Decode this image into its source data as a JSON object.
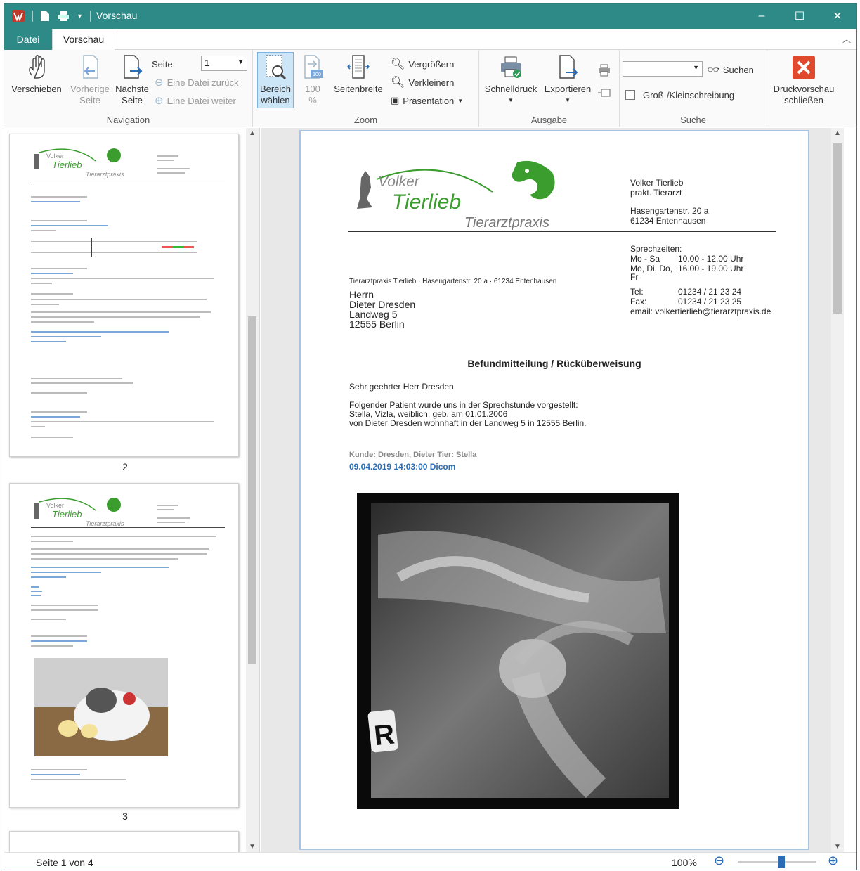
{
  "window": {
    "title": "Vorschau",
    "minimize": "–",
    "maximize": "☐",
    "close": "✕"
  },
  "menu": {
    "file": "Datei",
    "preview": "Vorschau"
  },
  "ribbon": {
    "navigation": {
      "group_label": "Navigation",
      "move": "Verschieben",
      "prev_page_1": "Vorherige",
      "prev_page_2": "Seite",
      "next_page_1": "Nächste",
      "next_page_2": "Seite",
      "page_label": "Seite:",
      "page_value": "1",
      "file_back": "Eine Datei zurück",
      "file_forward": "Eine Datei weiter"
    },
    "zoom": {
      "group_label": "Zoom",
      "area_1": "Bereich",
      "area_2": "wählen",
      "hundred_1": "100",
      "hundred_2": "%",
      "icon_100": "100",
      "page_width": "Seitenbreite",
      "enlarge": "Vergrößern",
      "shrink": "Verkleinern",
      "presentation": "Präsentation"
    },
    "output": {
      "group_label": "Ausgabe",
      "quick_print": "Schnelldruck",
      "export": "Exportieren"
    },
    "search": {
      "group_label": "Suche",
      "search": "Suchen",
      "case": "Groß-/Kleinschreibung",
      "value": ""
    },
    "close_1": "Druckvorschau",
    "close_2": "schließen"
  },
  "thumbnails": [
    {
      "number": "2"
    },
    {
      "number": "3"
    }
  ],
  "document": {
    "logo_line1": "Volker",
    "logo_line2": "Tierlieb",
    "logo_line3": "Tierarztpraxis",
    "vet_name": "Volker Tierlieb",
    "vet_title": "prakt. Tierarzt",
    "street": "Hasengartenstr.  20 a",
    "city": "61234 Entenhausen",
    "hours_title": "Sprechzeiten:",
    "hours": [
      [
        "Mo - Sa",
        "10.00 - 12.00 Uhr"
      ],
      [
        "Mo, Di, Do,",
        "16.00 - 19.00 Uhr"
      ]
    ],
    "hours_fr": "Fr",
    "tel_label": "Tel:",
    "tel": "01234 / 21 23 24",
    "fax_label": "Fax:",
    "fax": "01234 / 21 23 25",
    "email": "email: volkertierlieb@tierarztpraxis.de",
    "sender_line": "Tierarztpraxis Tierlieb · Hasengartenstr. 20 a · 61234  Entenhausen",
    "address": [
      "Herrn",
      "Dieter Dresden",
      "Landweg 5",
      "12555 Berlin"
    ],
    "subject": "Befundmitteilung / Rücküberweisung",
    "salutation": "Sehr geehrter Herr Dresden,",
    "body": [
      "Folgender Patient wurde uns  in der Sprechstunde vorgestellt:",
      "Stella, Vizla, weiblich, geb. am 01.01.2006",
      "von Dieter Dresden wohnhaft in der Landweg 5 in 12555 Berlin."
    ],
    "customer_line": "Kunde: Dresden, Dieter   Tier: Stella",
    "entry_line": "09.04.2019 14:03:00 Dicom",
    "xray_marker": "R"
  },
  "status": {
    "page": "Seite 1 von 4",
    "zoom": "100%",
    "zoom_level": 0.55
  }
}
